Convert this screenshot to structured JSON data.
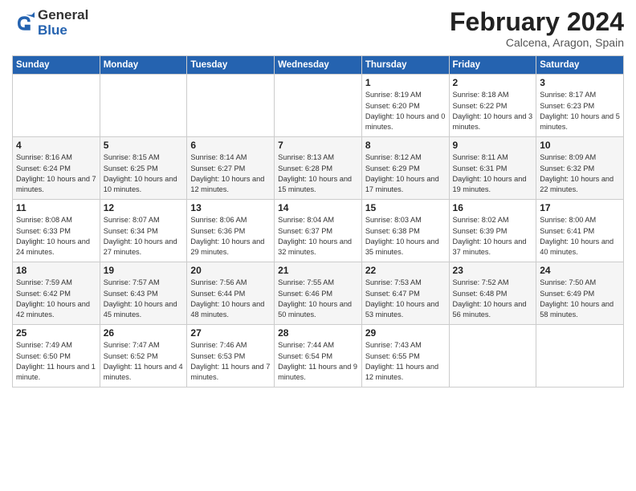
{
  "header": {
    "logo_line1": "General",
    "logo_line2": "Blue",
    "month_title": "February 2024",
    "location": "Calcena, Aragon, Spain"
  },
  "days_of_week": [
    "Sunday",
    "Monday",
    "Tuesday",
    "Wednesday",
    "Thursday",
    "Friday",
    "Saturday"
  ],
  "weeks": [
    [
      {
        "day": "",
        "info": ""
      },
      {
        "day": "",
        "info": ""
      },
      {
        "day": "",
        "info": ""
      },
      {
        "day": "",
        "info": ""
      },
      {
        "day": "1",
        "info": "Sunrise: 8:19 AM\nSunset: 6:20 PM\nDaylight: 10 hours\nand 0 minutes."
      },
      {
        "day": "2",
        "info": "Sunrise: 8:18 AM\nSunset: 6:22 PM\nDaylight: 10 hours\nand 3 minutes."
      },
      {
        "day": "3",
        "info": "Sunrise: 8:17 AM\nSunset: 6:23 PM\nDaylight: 10 hours\nand 5 minutes."
      }
    ],
    [
      {
        "day": "4",
        "info": "Sunrise: 8:16 AM\nSunset: 6:24 PM\nDaylight: 10 hours\nand 7 minutes."
      },
      {
        "day": "5",
        "info": "Sunrise: 8:15 AM\nSunset: 6:25 PM\nDaylight: 10 hours\nand 10 minutes."
      },
      {
        "day": "6",
        "info": "Sunrise: 8:14 AM\nSunset: 6:27 PM\nDaylight: 10 hours\nand 12 minutes."
      },
      {
        "day": "7",
        "info": "Sunrise: 8:13 AM\nSunset: 6:28 PM\nDaylight: 10 hours\nand 15 minutes."
      },
      {
        "day": "8",
        "info": "Sunrise: 8:12 AM\nSunset: 6:29 PM\nDaylight: 10 hours\nand 17 minutes."
      },
      {
        "day": "9",
        "info": "Sunrise: 8:11 AM\nSunset: 6:31 PM\nDaylight: 10 hours\nand 19 minutes."
      },
      {
        "day": "10",
        "info": "Sunrise: 8:09 AM\nSunset: 6:32 PM\nDaylight: 10 hours\nand 22 minutes."
      }
    ],
    [
      {
        "day": "11",
        "info": "Sunrise: 8:08 AM\nSunset: 6:33 PM\nDaylight: 10 hours\nand 24 minutes."
      },
      {
        "day": "12",
        "info": "Sunrise: 8:07 AM\nSunset: 6:34 PM\nDaylight: 10 hours\nand 27 minutes."
      },
      {
        "day": "13",
        "info": "Sunrise: 8:06 AM\nSunset: 6:36 PM\nDaylight: 10 hours\nand 29 minutes."
      },
      {
        "day": "14",
        "info": "Sunrise: 8:04 AM\nSunset: 6:37 PM\nDaylight: 10 hours\nand 32 minutes."
      },
      {
        "day": "15",
        "info": "Sunrise: 8:03 AM\nSunset: 6:38 PM\nDaylight: 10 hours\nand 35 minutes."
      },
      {
        "day": "16",
        "info": "Sunrise: 8:02 AM\nSunset: 6:39 PM\nDaylight: 10 hours\nand 37 minutes."
      },
      {
        "day": "17",
        "info": "Sunrise: 8:00 AM\nSunset: 6:41 PM\nDaylight: 10 hours\nand 40 minutes."
      }
    ],
    [
      {
        "day": "18",
        "info": "Sunrise: 7:59 AM\nSunset: 6:42 PM\nDaylight: 10 hours\nand 42 minutes."
      },
      {
        "day": "19",
        "info": "Sunrise: 7:57 AM\nSunset: 6:43 PM\nDaylight: 10 hours\nand 45 minutes."
      },
      {
        "day": "20",
        "info": "Sunrise: 7:56 AM\nSunset: 6:44 PM\nDaylight: 10 hours\nand 48 minutes."
      },
      {
        "day": "21",
        "info": "Sunrise: 7:55 AM\nSunset: 6:46 PM\nDaylight: 10 hours\nand 50 minutes."
      },
      {
        "day": "22",
        "info": "Sunrise: 7:53 AM\nSunset: 6:47 PM\nDaylight: 10 hours\nand 53 minutes."
      },
      {
        "day": "23",
        "info": "Sunrise: 7:52 AM\nSunset: 6:48 PM\nDaylight: 10 hours\nand 56 minutes."
      },
      {
        "day": "24",
        "info": "Sunrise: 7:50 AM\nSunset: 6:49 PM\nDaylight: 10 hours\nand 58 minutes."
      }
    ],
    [
      {
        "day": "25",
        "info": "Sunrise: 7:49 AM\nSunset: 6:50 PM\nDaylight: 11 hours\nand 1 minute."
      },
      {
        "day": "26",
        "info": "Sunrise: 7:47 AM\nSunset: 6:52 PM\nDaylight: 11 hours\nand 4 minutes."
      },
      {
        "day": "27",
        "info": "Sunrise: 7:46 AM\nSunset: 6:53 PM\nDaylight: 11 hours\nand 7 minutes."
      },
      {
        "day": "28",
        "info": "Sunrise: 7:44 AM\nSunset: 6:54 PM\nDaylight: 11 hours\nand 9 minutes."
      },
      {
        "day": "29",
        "info": "Sunrise: 7:43 AM\nSunset: 6:55 PM\nDaylight: 11 hours\nand 12 minutes."
      },
      {
        "day": "",
        "info": ""
      },
      {
        "day": "",
        "info": ""
      }
    ]
  ]
}
